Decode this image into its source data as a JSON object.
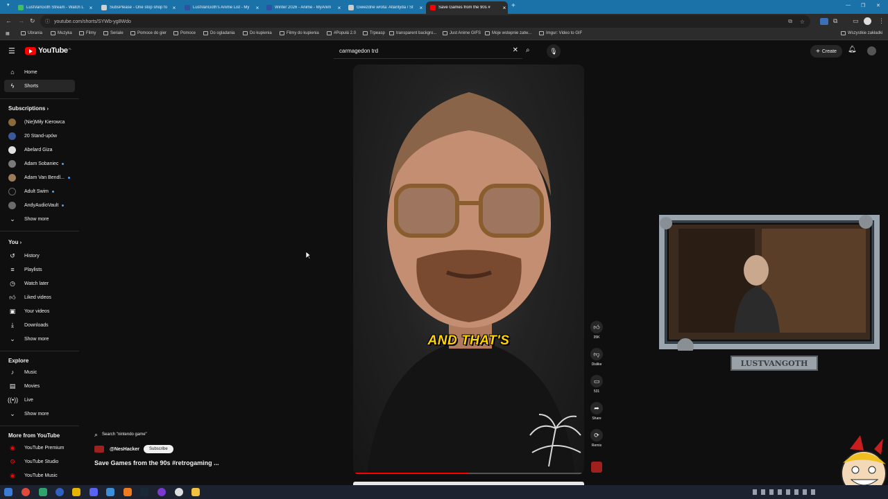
{
  "browser": {
    "tabs": [
      {
        "title": "LustVanGoth Stream - Watch L",
        "color": "#3fbf5f"
      },
      {
        "title": "SubsPlease - One stop shop fo",
        "color": "#d0d0d0"
      },
      {
        "title": "LustVanGoth's Anime List - My",
        "color": "#2e51a2"
      },
      {
        "title": "Winter 2026 - Anime - MyAnim",
        "color": "#2e51a2"
      },
      {
        "title": "Gwiezdne wrota: Atlantyda / St",
        "color": "#cccccc"
      },
      {
        "title": "Save Games from the 90s #",
        "color": "#ff0000"
      }
    ],
    "url": "youtube.com/shorts/SYWb-yg8Wdo",
    "bookmarks": [
      "Ubrania",
      "Muzyka",
      "Filmy",
      "Seriale",
      "Pomoce do gier",
      "Pomoce",
      "Do ogladania",
      "Do kupienia",
      "Filmy do kupienia",
      "#Popułá 2.0",
      "Trpeasp",
      "transparent backgro...",
      "Just Anime GIFS",
      "Moje wstepnie zatw...",
      "Imgur: Video to GIF"
    ],
    "bookmarks_right": "Wszystkie zakładki",
    "icons": [
      "back-icon",
      "forward-icon",
      "reload-icon",
      "info-icon",
      "bookmark-star-icon",
      "extensions-icon",
      "profile-icon",
      "menu-icon"
    ]
  },
  "youtube": {
    "logo_text": "YouTube",
    "logo_country": "PL",
    "search_value": "carmagedon trd",
    "create_label": "Create"
  },
  "sidebar": {
    "main": [
      {
        "label": "Home",
        "icon": "home-icon"
      },
      {
        "label": "Shorts",
        "icon": "shorts-icon"
      }
    ],
    "subscriptions_title": "Subscriptions",
    "subscriptions": [
      {
        "label": "(Nie)Miły Kierowca",
        "color": "#8a6a3a",
        "dot": false
      },
      {
        "label": "20 Stand-upów",
        "color": "#3b5998",
        "dot": false
      },
      {
        "label": "Abelard Giza",
        "color": "#e0e0e0",
        "dot": false
      },
      {
        "label": "Adam Sobaniec",
        "color": "#7a7a7a",
        "dot": true
      },
      {
        "label": "Adam Van Bendl...",
        "color": "#9c7b5b",
        "dot": true
      },
      {
        "label": "Adult Swim",
        "color": "#111111",
        "dot": true
      },
      {
        "label": "AndyAudioVault",
        "color": "#6b6b6b",
        "dot": true
      }
    ],
    "subs_show_more": "Show more",
    "you_title": "You",
    "you": [
      {
        "label": "History",
        "icon": "history-icon"
      },
      {
        "label": "Playlists",
        "icon": "playlists-icon"
      },
      {
        "label": "Watch later",
        "icon": "watch-later-icon"
      },
      {
        "label": "Liked videos",
        "icon": "liked-icon"
      },
      {
        "label": "Your videos",
        "icon": "your-videos-icon"
      },
      {
        "label": "Downloads",
        "icon": "downloads-icon"
      }
    ],
    "you_show_more": "Show more",
    "explore_title": "Explore",
    "explore": [
      {
        "label": "Music",
        "icon": "music-icon"
      },
      {
        "label": "Movies",
        "icon": "movies-icon"
      },
      {
        "label": "Live",
        "icon": "live-icon"
      }
    ],
    "explore_show_more": "Show more",
    "more_title": "More from YouTube",
    "more": [
      {
        "label": "YouTube Premium"
      },
      {
        "label": "YouTube Studio"
      },
      {
        "label": "YouTube Music"
      }
    ]
  },
  "short": {
    "search_chip": "Search \"nintendo game\"",
    "channel": "@NesHacker",
    "subscribe": "Subscribe",
    "title": "Save Games from the 90s #retrogaming ...",
    "caption": "AND THAT'S",
    "progress": 0.5,
    "actions": [
      {
        "label": "35K",
        "icon": "like-icon"
      },
      {
        "label": "Dislike",
        "icon": "dislike-icon"
      },
      {
        "label": "531",
        "icon": "comment-icon"
      },
      {
        "label": "Share",
        "icon": "share-icon"
      },
      {
        "label": "Remix",
        "icon": "remix-icon"
      }
    ]
  },
  "overlay": {
    "name": "LUSTVANGOTH"
  }
}
